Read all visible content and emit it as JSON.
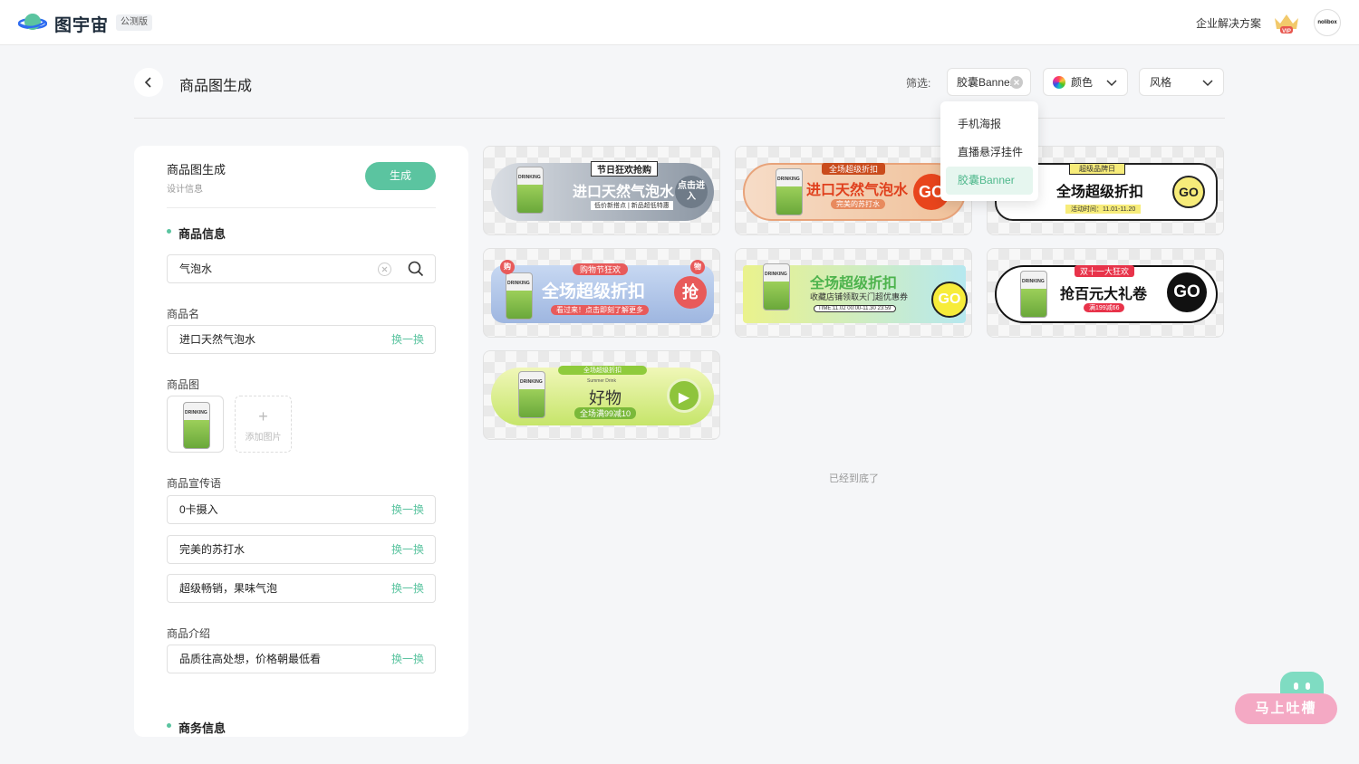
{
  "topbar": {
    "brand": "图宇宙",
    "badge": "公测版",
    "enterprise": "企业解决方案",
    "vip": "VIP",
    "avatar_text": "nolibox"
  },
  "header": {
    "title": "商品图生成",
    "filter_label": "筛选:",
    "filter_selected": "胶囊Banner",
    "filter_color": "颜色",
    "filter_style": "风格"
  },
  "dropdown": {
    "items": [
      "手机海报",
      "直播悬浮挂件",
      "胶囊Banner"
    ],
    "selected_index": 2
  },
  "panel": {
    "title": "商品图生成",
    "subtitle": "设计信息",
    "generate_label": "生成",
    "section_product": "商品信息",
    "search_value": "气泡水",
    "name_label": "商品名",
    "name_value": "进口天然气泡水",
    "swap_label": "换一换",
    "image_label": "商品图",
    "add_image_label": "添加图片",
    "slogan_label": "商品宣传语",
    "slogans": [
      "0卡摄入",
      "完美的苏打水",
      "超级畅销，果味气泡"
    ],
    "intro_label": "商品介绍",
    "intro_value": "品质往高处想，价格朝最低看",
    "section_business": "商务信息"
  },
  "banners": [
    {
      "tag": "节日狂欢抢购",
      "title": "进口天然气泡水",
      "sub": "低价新搭点 | 新品超低特惠",
      "action": "点击进入"
    },
    {
      "tag": "全场超级折扣",
      "title": "进口天然气泡水",
      "sub": "完美的苏打水",
      "action": "GO"
    },
    {
      "tag": "超级品牌日",
      "title": "全场超级折扣",
      "sub": "活动时间：11.01-11.20",
      "action": "GO"
    },
    {
      "tag": "购物节狂欢",
      "title": "全场超级折扣",
      "sub": "看过来！点击即刻了解更多",
      "action": "抢",
      "left_badge": "购",
      "right_badge": "物"
    },
    {
      "tag": "",
      "title": "全场超级折扣",
      "sub": "收藏店铺领取天门超优惠券",
      "time": "TIME:11.02 00:00-11.30 23:59",
      "action": "GO"
    },
    {
      "tag": "双十一大狂欢",
      "title": "抢百元大礼卷",
      "sub": "满199减66",
      "action": "GO"
    },
    {
      "tag": "全场超级折扣",
      "title": "好物",
      "sub": "全场满99减10",
      "small": "Summer Drink",
      "action": "▶"
    }
  ],
  "status": {
    "end": "已经到底了"
  },
  "feedback": {
    "label": "马上吐槽"
  },
  "colors": {
    "accent": "#5bc4a0",
    "accent_light": "#e6f6ef",
    "feedback_pink": "#f4a9c4"
  }
}
